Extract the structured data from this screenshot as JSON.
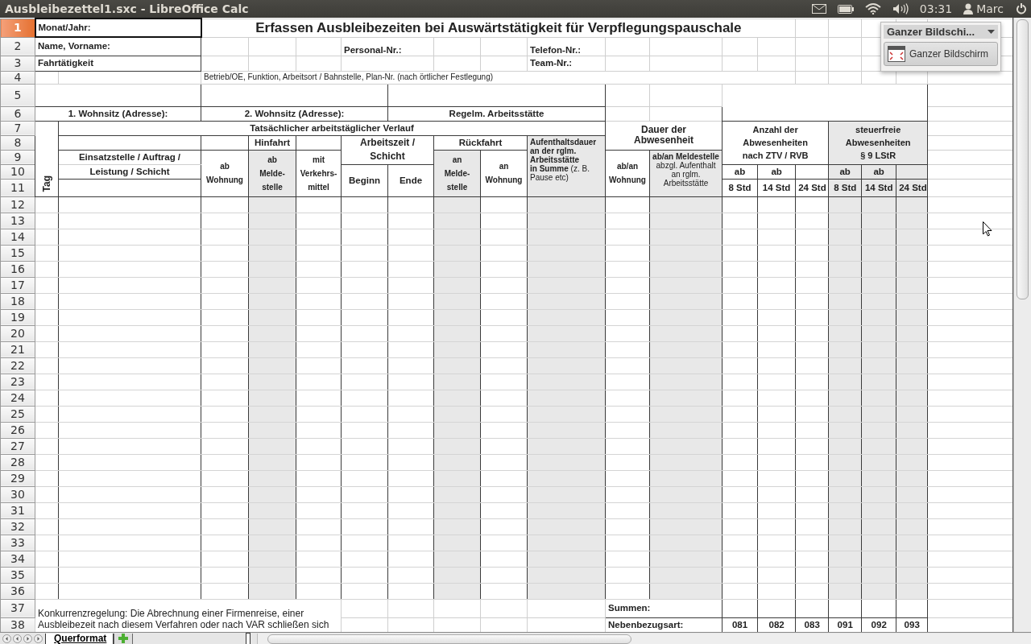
{
  "window": {
    "title": "Ausbleibezettel1.sxc - LibreOffice Calc"
  },
  "top_panel": {
    "time": "03:31",
    "user": "Marc"
  },
  "row_headers": [
    {
      "label": "1",
      "selected": true
    },
    {
      "label": "2",
      "selected": false
    },
    {
      "label": "3",
      "selected": false
    },
    {
      "label": "4",
      "selected": false
    },
    {
      "label": "5",
      "selected": false
    },
    {
      "label": "6",
      "selected": false
    },
    {
      "label": "7",
      "selected": false
    },
    {
      "label": "8",
      "selected": false
    },
    {
      "label": "9",
      "selected": false
    },
    {
      "label": "10",
      "selected": false
    },
    {
      "label": "11",
      "selected": false
    },
    {
      "label": "12",
      "selected": false
    },
    {
      "label": "13",
      "selected": false
    },
    {
      "label": "14",
      "selected": false
    },
    {
      "label": "15",
      "selected": false
    },
    {
      "label": "16",
      "selected": false
    },
    {
      "label": "17",
      "selected": false
    },
    {
      "label": "18",
      "selected": false
    },
    {
      "label": "19",
      "selected": false
    },
    {
      "label": "20",
      "selected": false
    },
    {
      "label": "21",
      "selected": false
    },
    {
      "label": "22",
      "selected": false
    },
    {
      "label": "23",
      "selected": false
    },
    {
      "label": "24",
      "selected": false
    },
    {
      "label": "25",
      "selected": false
    },
    {
      "label": "26",
      "selected": false
    },
    {
      "label": "27",
      "selected": false
    },
    {
      "label": "28",
      "selected": false
    },
    {
      "label": "29",
      "selected": false
    },
    {
      "label": "30",
      "selected": false
    },
    {
      "label": "31",
      "selected": false
    },
    {
      "label": "32",
      "selected": false
    },
    {
      "label": "33",
      "selected": false
    },
    {
      "label": "34",
      "selected": false
    },
    {
      "label": "35",
      "selected": false
    },
    {
      "label": "36",
      "selected": false
    },
    {
      "label": "37",
      "selected": false
    },
    {
      "label": "38",
      "selected": false
    }
  ],
  "form": {
    "month_label": "Monat/Jahr:",
    "title": "Erfassen Ausbleibezeiten bei Auswärtstätigkeit für Verpflegungspauschale",
    "name_label": "Name, Vorname:",
    "personnel_label": "Personal-Nr.:",
    "phone_label": "Telefon-Nr.:",
    "driving_label": "Fahrtätigkeit",
    "team_label": "Team-Nr.:",
    "unit_hint": "Betrieb/OE, Funktion, Arbeitsort / Bahnstelle, Plan-Nr. (nach örtlicher Festlegung)",
    "home1_label": "1. Wohnsitz (Adresse):",
    "home2_label": "2. Wohnsitz (Adresse):",
    "workplace_label": "Regelm. Arbeitsstätte"
  },
  "columns": {
    "day": "Tag",
    "course": "Tatsächlicher arbeitstäglicher Verlauf",
    "assignment": [
      "Einsatzstelle / Auftrag /",
      "Leistung / Schicht"
    ],
    "outbound": "Hinfahrt",
    "from_home": [
      "ab",
      "Wohnung"
    ],
    "to_office": [
      "ab",
      "Melde-",
      "stelle"
    ],
    "transport": [
      "mit",
      "Verkehrs-",
      "mittel"
    ],
    "worktime": [
      "Arbeitszeit /",
      "Schicht"
    ],
    "start": "Beginn",
    "end": "Ende",
    "return": "Rückfahrt",
    "at_office": [
      "an",
      "Melde-",
      "stelle"
    ],
    "at_home": [
      "an",
      "Wohnung"
    ],
    "stay": [
      "**Aufenthaltsdauer**",
      "**an der rglm.**",
      "**Arbeitsstätte**",
      "**in Summe** (z. B.",
      "Pause etc)"
    ],
    "duration": [
      "Dauer der",
      "Abwesenheit"
    ],
    "dur_home": [
      "ab/an",
      "Wohnung"
    ],
    "dur_office": [
      "**ab/an Meldestelle**",
      "abzgl. Aufenthalt",
      "an rglm.",
      "Arbeitsstätte"
    ],
    "count": [
      "Anzahl der",
      "Abwesenheiten",
      "nach ZTV / RVB"
    ],
    "taxfree": [
      "steuerfreie",
      "Abwesenheiten",
      "§ 9 LStR"
    ]
  },
  "allowances": [
    {
      "top": "ab",
      "bottom": "8 Std",
      "code": "081"
    },
    {
      "top": "ab",
      "bottom": "14 Std",
      "code": "082"
    },
    {
      "bottom": "24 Std",
      "code": "083"
    },
    {
      "top": "ab",
      "bottom": "8 Std",
      "code": "091"
    },
    {
      "top": "ab",
      "bottom": "14 Std",
      "code": "092"
    },
    {
      "bottom": "24 Std",
      "code": "093"
    }
  ],
  "footer": {
    "note": "Konkurrenzregelung: Die Abrechnung einer Firmenreise, einer Ausbleibezeit nach diesem Verfahren oder nach VAR schließen sich",
    "sum_label": "Summen:",
    "type_label": "Nebenbezugsart:"
  },
  "popup": {
    "title": "Ganzer Bildschi...",
    "button": "Ganzer Bildschirm"
  },
  "sheet_tabs": [
    {
      "label": "Querformat",
      "selected": true
    }
  ]
}
